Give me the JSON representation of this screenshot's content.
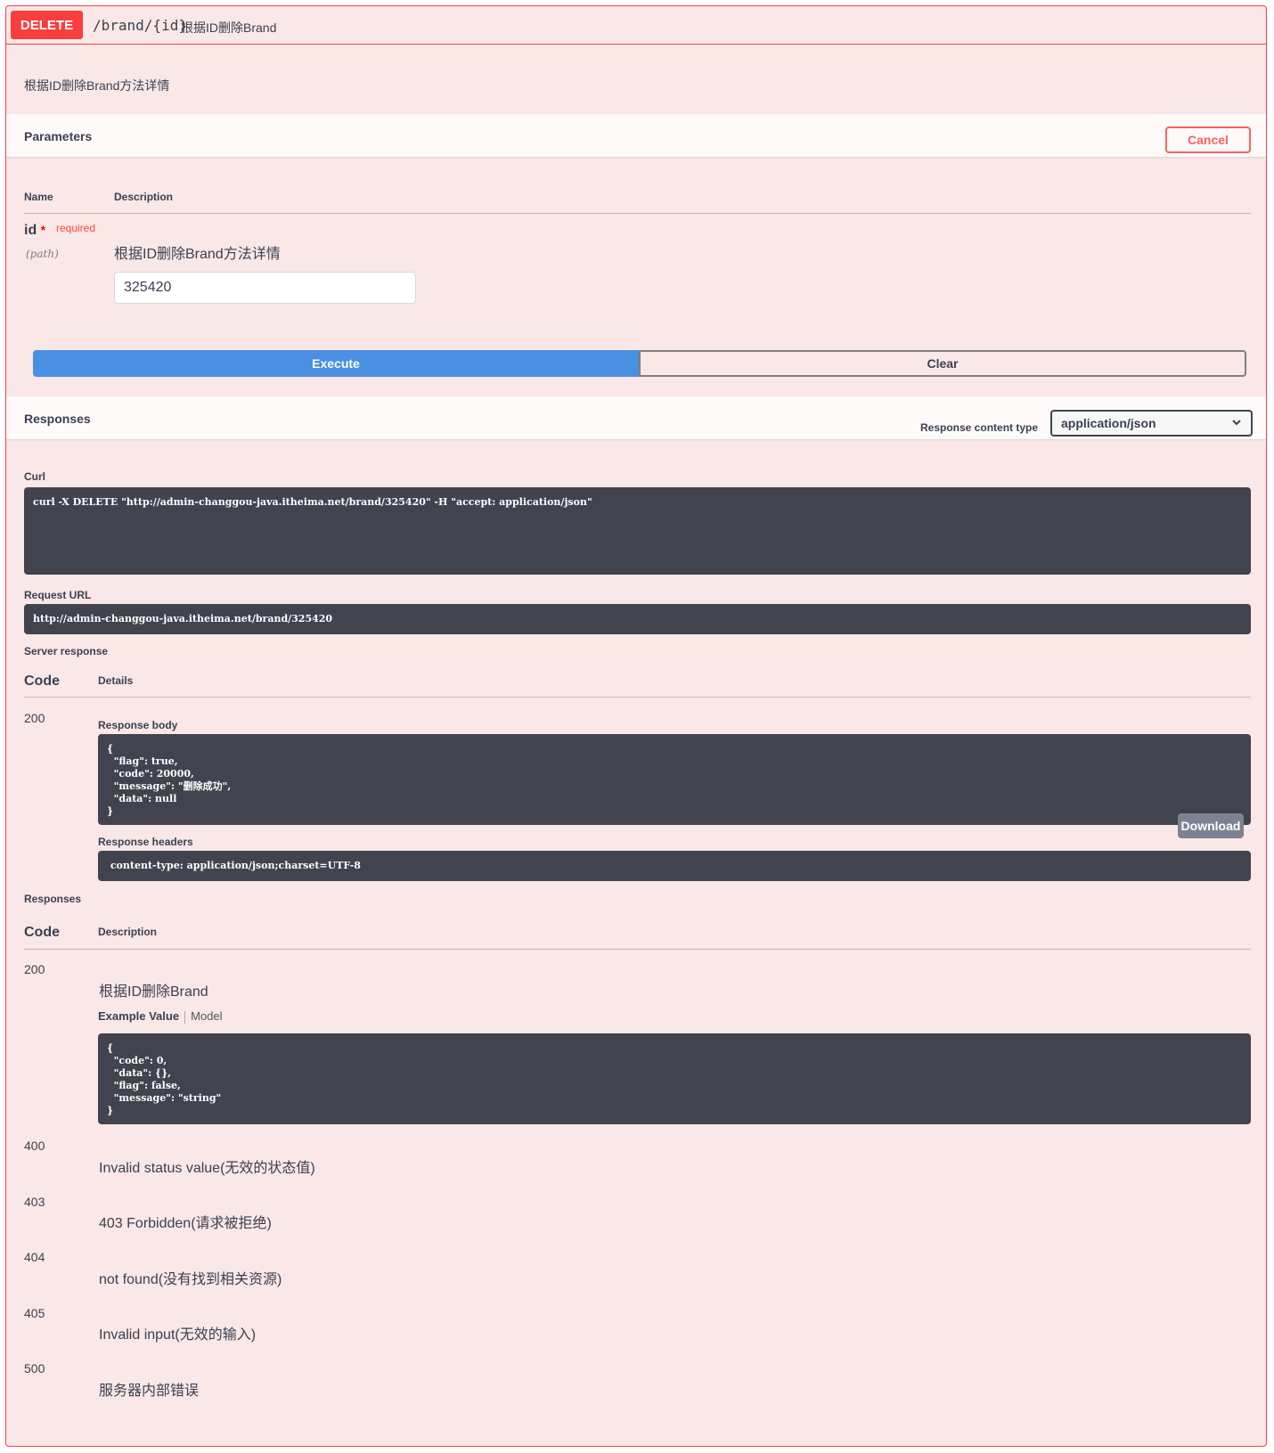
{
  "summary": {
    "method": "DELETE",
    "path": "/brand/{id}",
    "description": "根据ID删除Brand"
  },
  "description": "根据ID删除Brand方法详情",
  "parameters": {
    "title": "Parameters",
    "cancel_label": "Cancel",
    "col_name": "Name",
    "col_description": "Description",
    "items": [
      {
        "name": "id",
        "star": "*",
        "required": "required",
        "in": "(path)",
        "description": "根据ID删除Brand方法详情",
        "value": "325420"
      }
    ]
  },
  "actions": {
    "execute_label": "Execute",
    "clear_label": "Clear"
  },
  "responses_section": {
    "title": "Responses",
    "content_type_label": "Response content type",
    "content_type_value": "application/json",
    "curl_label": "Curl",
    "curl": "curl -X DELETE \"http://admin-changgou-java.itheima.net/brand/325420\" -H \"accept: application/json\"",
    "request_url_label": "Request URL",
    "request_url": "http://admin-changgou-java.itheima.net/brand/325420",
    "server_response_label": "Server response",
    "col_code": "Code",
    "col_details": "Details",
    "server_code": "200",
    "response_body_label": "Response body",
    "response_body": "{\n  \"flag\": true,\n  \"code\": 20000,\n  \"message\": \"删除成功\",\n  \"data\": null\n}",
    "download_label": "Download",
    "response_headers_label": "Response headers",
    "response_headers": " content-type: application/json;charset=UTF-8 "
  },
  "documented_responses": {
    "title": "Responses",
    "col_code": "Code",
    "col_description": "Description",
    "example_value_tab": "Example Value",
    "model_tab": "Model",
    "example_value": "{\n  \"code\": 0,\n  \"data\": {},\n  \"flag\": false,\n  \"message\": \"string\"\n}",
    "items": [
      {
        "code": "200",
        "description": "根据ID删除Brand"
      },
      {
        "code": "400",
        "description": "Invalid status value(无效的状态值)"
      },
      {
        "code": "403",
        "description": "403 Forbidden(请求被拒绝)"
      },
      {
        "code": "404",
        "description": "not found(没有找到相关资源)"
      },
      {
        "code": "405",
        "description": "Invalid input(无效的输入)"
      },
      {
        "code": "500",
        "description": "服务器内部错误"
      }
    ]
  },
  "colors": {
    "delete": "#f93e3e",
    "background": "#fae7e7",
    "execute": "#4990e2",
    "code_block": "#41444e"
  }
}
